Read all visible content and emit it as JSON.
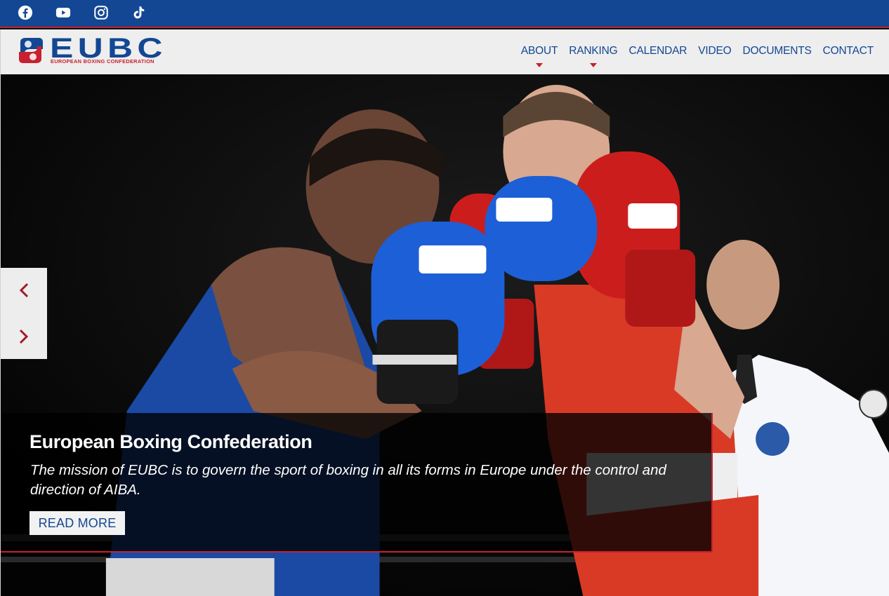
{
  "social": [
    {
      "name": "facebook"
    },
    {
      "name": "youtube"
    },
    {
      "name": "instagram"
    },
    {
      "name": "tiktok"
    }
  ],
  "logo": {
    "word": "EUBC",
    "subtitle": "EUROPEAN BOXING CONFEDERATION"
  },
  "nav": {
    "items": [
      {
        "label": "ABOUT",
        "dropdown": true
      },
      {
        "label": "RANKING",
        "dropdown": true
      },
      {
        "label": "CALENDAR",
        "dropdown": false
      },
      {
        "label": "VIDEO",
        "dropdown": false
      },
      {
        "label": "DOCUMENTS",
        "dropdown": false
      },
      {
        "label": "CONTACT",
        "dropdown": false
      }
    ]
  },
  "slider": {
    "prev_icon": "chevron-left-icon",
    "next_icon": "chevron-right-icon"
  },
  "caption": {
    "title": "European Boxing Confederation",
    "text": "The mission of EUBC is to govern the sport of boxing in all its forms in Europe under the control and direction of AIBA.",
    "button_label": "READ MORE"
  },
  "colors": {
    "brand_blue": "#134793",
    "brand_red": "#c8202f",
    "header_bg": "#eeeeee"
  }
}
